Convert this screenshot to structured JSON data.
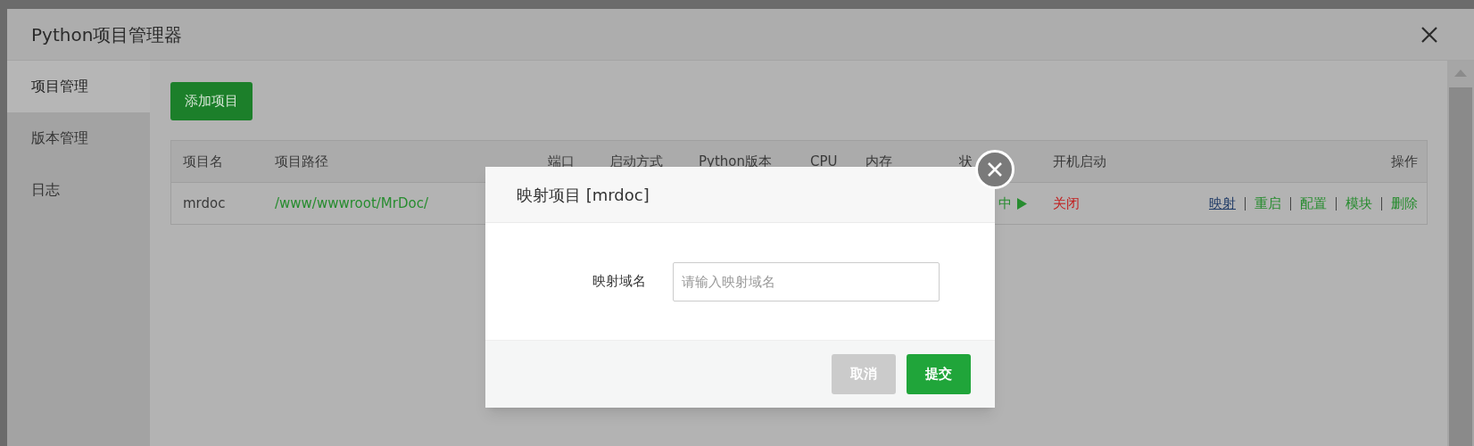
{
  "window": {
    "title": "Python项目管理器"
  },
  "sidebar": {
    "items": [
      {
        "label": "项目管理",
        "selected": true
      },
      {
        "label": "版本管理",
        "selected": false
      },
      {
        "label": "日志",
        "selected": false
      }
    ]
  },
  "add_button": "添加项目",
  "table": {
    "columns": [
      "项目名",
      "项目路径",
      "端口",
      "启动方式",
      "Python版本",
      "CPU",
      "内存",
      "状",
      "开机启动",
      "操作"
    ],
    "rows": [
      {
        "name": "mrdoc",
        "path": "/www/wwwroot/MrDoc/",
        "status": "中",
        "autostart": "关闭",
        "actions": [
          {
            "label": "映射",
            "selected": true
          },
          {
            "label": "重启",
            "selected": false
          },
          {
            "label": "配置",
            "selected": false
          },
          {
            "label": "模块",
            "selected": false
          },
          {
            "label": "删除",
            "selected": false
          }
        ]
      }
    ]
  },
  "modal": {
    "title": "映射项目 [mrdoc]",
    "field_label": "映射域名",
    "placeholder": "请输入映射域名",
    "buttons": [
      {
        "label": "取消",
        "kind": "cancel"
      },
      {
        "label": "提交",
        "kind": "submit"
      }
    ]
  }
}
